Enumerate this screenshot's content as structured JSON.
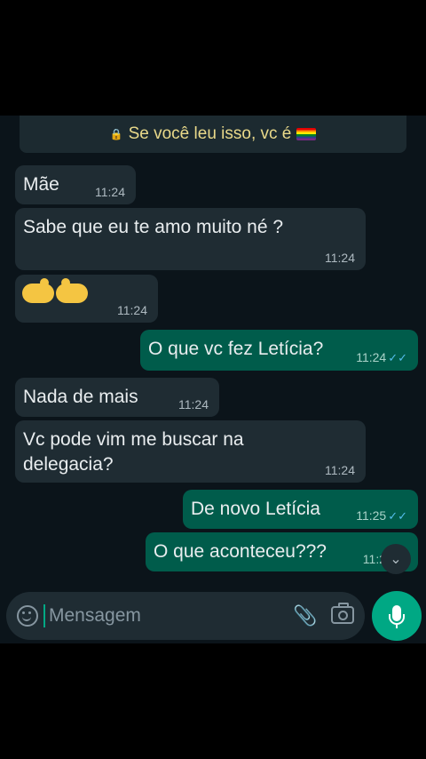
{
  "banner": {
    "text": "Se você leu isso, vc é"
  },
  "messages": [
    {
      "text": "Mãe",
      "time": "11:24"
    },
    {
      "text": "Sabe que eu te amo muito né ?",
      "time": "11:24"
    },
    {
      "text": "",
      "time": "11:24"
    },
    {
      "text": "O que vc fez Letícia?",
      "time": "11:24"
    },
    {
      "text": "Nada de mais",
      "time": "11:24"
    },
    {
      "text": "Vc pode vim me buscar na",
      "text2": "delegacia?",
      "time": "11:24"
    },
    {
      "text": "De novo Letícia",
      "time": "11:25"
    },
    {
      "text": "O que aconteceu???",
      "time": "11:2"
    }
  ],
  "input": {
    "placeholder": "Mensagem"
  },
  "colors": {
    "incoming": "#1f2c33",
    "outgoing": "#005c4b",
    "accent": "#00a884"
  }
}
